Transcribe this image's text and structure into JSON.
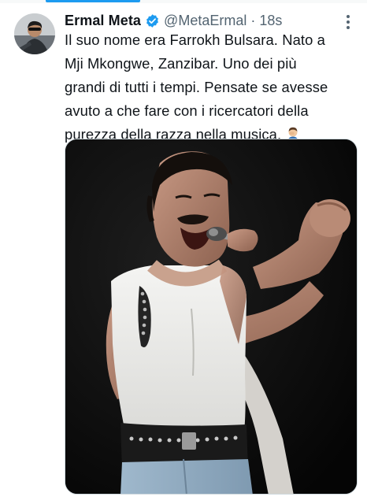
{
  "tweet": {
    "author_name": "Ermal Meta",
    "handle": "@MetaErmal",
    "separator": "·",
    "timestamp": "18s",
    "lines": [
      "Il suo nome era Farrokh Bulsara. Nato a",
      "Mji Mkongwe, Zanzibar. Uno dei più",
      "grandi di tutti i tempi. Pensate se avesse",
      "avuto a che fare con i ricercatori della",
      "purezza della razza nella musica."
    ],
    "verified": true
  },
  "colors": {
    "accent": "#1d9bf0",
    "text": "#0f1419",
    "secondary": "#536471"
  },
  "icons": {
    "verified": "verified-badge-icon",
    "more": "more-dots-icon",
    "emoji": "person-facepalm-emoji"
  }
}
